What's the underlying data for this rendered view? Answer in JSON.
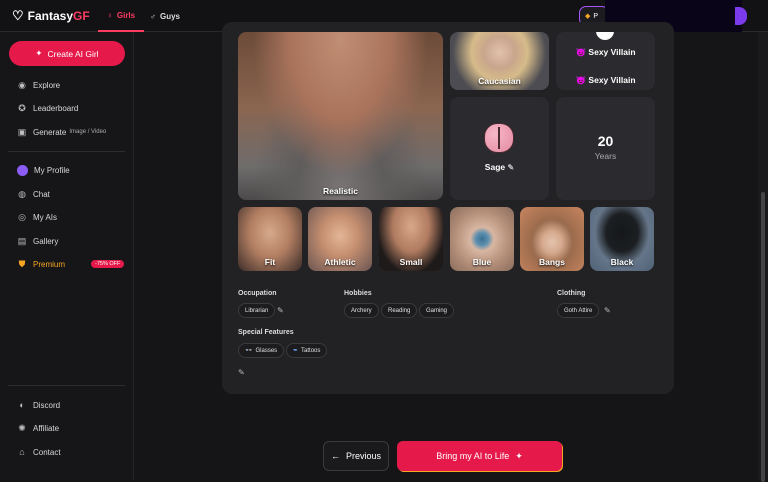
{
  "header": {
    "brand_prefix": "Fantasy",
    "brand_suffix": "GF",
    "tabs": [
      {
        "label": "Girls",
        "icon": "female-icon",
        "active": true
      },
      {
        "label": "Guys",
        "icon": "male-icon",
        "active": false
      }
    ],
    "premium_partial": "P"
  },
  "sidebar": {
    "create_label": "Create AI Girl",
    "items": [
      {
        "label": "Explore",
        "icon": "compass-icon"
      },
      {
        "label": "Leaderboard",
        "icon": "medal-icon"
      },
      {
        "label": "Generate",
        "sub": "Image / Video",
        "icon": "image-icon"
      },
      {
        "label": "My Profile",
        "icon": "avatar-icon"
      },
      {
        "label": "Chat",
        "icon": "chat-icon"
      },
      {
        "label": "My AIs",
        "icon": "ai-icon"
      },
      {
        "label": "Gallery",
        "icon": "gallery-icon"
      },
      {
        "label": "Premium",
        "icon": "shield-icon",
        "badge": "-75% OFF"
      },
      {
        "label": "Discord",
        "icon": "discord-icon"
      },
      {
        "label": "Affiliate",
        "icon": "affiliate-icon"
      },
      {
        "label": "Contact",
        "icon": "contact-icon"
      }
    ]
  },
  "summary": {
    "style": "Realistic",
    "ethnicity": "Caucasian",
    "personality_top": "Sexy Villain",
    "personality": "Sexy Villain",
    "voice": "Sage",
    "age": "20",
    "age_unit": "Years",
    "body": [
      "Fit",
      "Athletic",
      "Small",
      "Blue",
      "Bangs",
      "Black"
    ]
  },
  "details": {
    "occupation_label": "Occupation",
    "occupation": "Librarian",
    "hobbies_label": "Hobbies",
    "hobbies": [
      "Archery",
      "Reading",
      "Gaming"
    ],
    "clothing_label": "Clothing",
    "clothing": "Goth Attire",
    "features_label": "Special Features",
    "features": [
      "Glasses",
      "Tattoos"
    ]
  },
  "actions": {
    "previous": "Previous",
    "bring": "Bring my AI to Life"
  },
  "colors": {
    "accent": "#e5194a",
    "premium": "#f5a524",
    "purple": "#8b5cf6"
  }
}
